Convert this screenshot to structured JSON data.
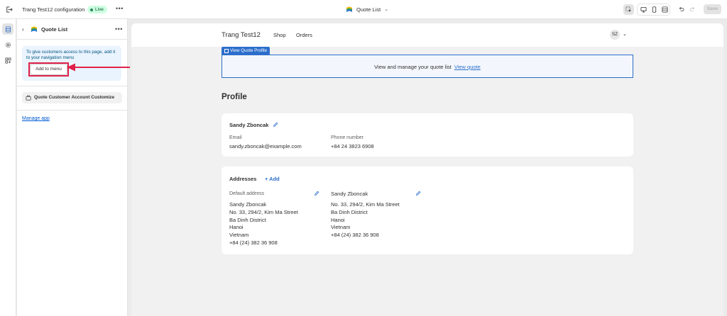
{
  "topbar": {
    "store_config_title": "Trang Test12 configuration",
    "live_badge": "Live",
    "more": "•••",
    "page_selector": "Quote List",
    "save_label": "Save"
  },
  "panel": {
    "title": "Quote List",
    "more": "•••",
    "info_text": "To give customers access to this page, add it to your navigation menu",
    "add_to_menu": "Add to menu",
    "block_label": "Quote Customer Account Customize",
    "manage_app": "Manage app"
  },
  "store": {
    "name": "Trang Test12",
    "nav": [
      "Shop",
      "Orders"
    ],
    "avatar_initials": "SZ"
  },
  "quote_profile": {
    "tag": "View Quote Profile",
    "text": "View and manage your quote list",
    "link": "View quote"
  },
  "profile": {
    "heading": "Profile",
    "name": "Sandy Zboncak",
    "email_label": "Email",
    "email": "sandy.zboncak@example.com",
    "phone_label": "Phone number",
    "phone": "+84 24 3823 6908"
  },
  "addresses": {
    "heading": "Addresses",
    "add_label": "+ Add",
    "default_label": "Default address",
    "default_lines": [
      "Sandy Zboncak",
      "No. 33, 294/2, Kim Ma Street",
      "Ba Dinh District",
      "Hanoi",
      "Vietnam",
      "+84 (24) 382 36 908"
    ],
    "second_name": "Sandy Zboncak",
    "second_lines": [
      "No. 33, 294/2, Kim Ma Street",
      "Ba Dinh District",
      "Hanoi",
      "Vietnam",
      "+84 (24) 382 36 908"
    ]
  },
  "colors": {
    "accent": "#2c6ecb",
    "live_green": "#29845a",
    "annotation_red": "#e0224a",
    "info_bg": "#eaf4ff"
  }
}
